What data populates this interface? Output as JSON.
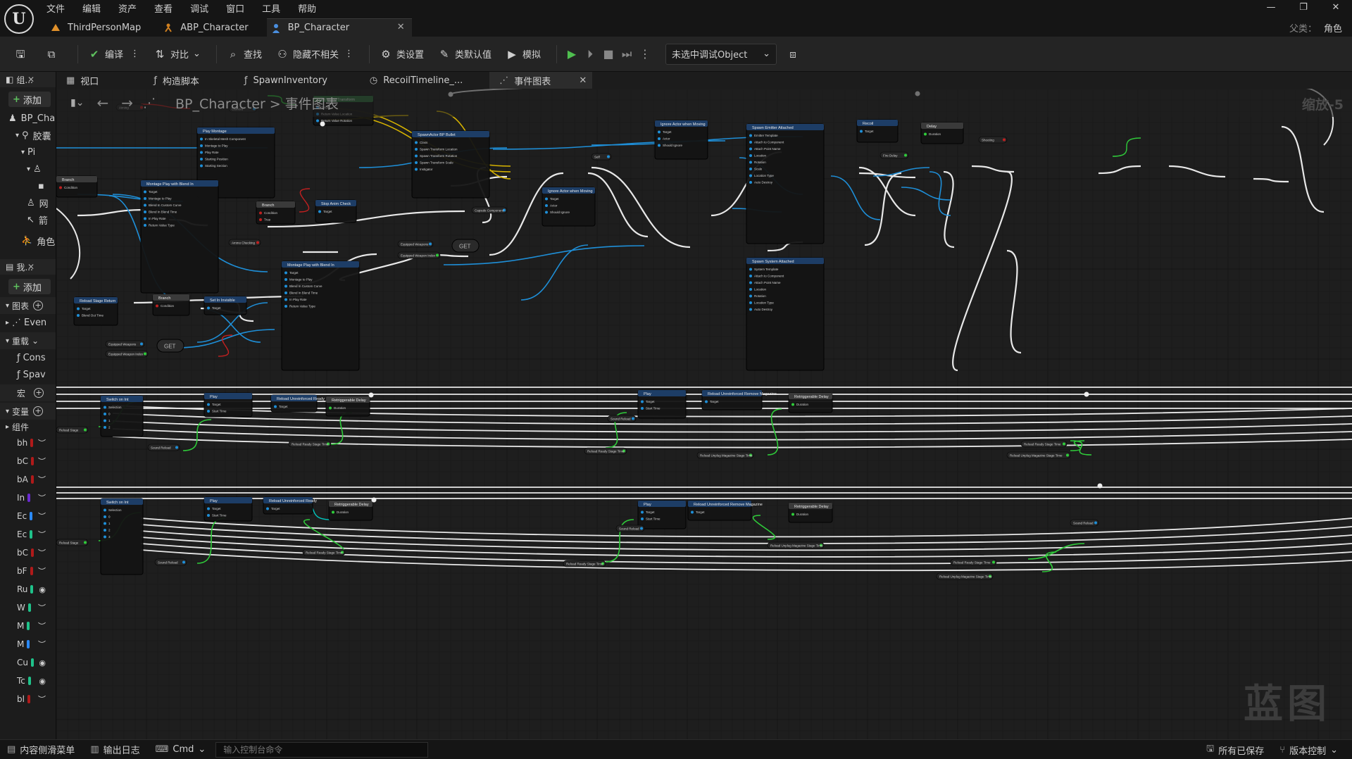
{
  "window": {
    "menu": [
      "文件",
      "编辑",
      "资产",
      "查看",
      "调试",
      "窗口",
      "工具",
      "帮助"
    ],
    "tabs": [
      {
        "label": "ThirdPersonMap",
        "icon": "level-icon"
      },
      {
        "label": "ABP_Character",
        "icon": "anim-blueprint-icon"
      },
      {
        "label": "BP_Character",
        "icon": "blueprint-character-icon",
        "active": true
      }
    ],
    "parent_key": "父类：",
    "parent_value": "角色"
  },
  "toolbar": {
    "compile": "编译",
    "diff": "对比",
    "find": "查找",
    "hide_unrelated": "隐藏不相关",
    "class_settings": "类设置",
    "class_defaults": "类默认值",
    "simulate": "模拟",
    "debug_object": "未选中调试Object"
  },
  "left": {
    "components_header": "组...",
    "add_label": "添加",
    "root_item": "BP_Char",
    "capsule_item": "胶囊",
    "pi_item": "Pi",
    "web_item": "网",
    "arrow_item": "箭",
    "movement_item": "角色",
    "mybp_header": "我...",
    "graphs_section": "图表",
    "event_graph": "Even",
    "overrides_section": "重载",
    "construction": "Cons",
    "spawn": "Spav",
    "macros_section": "宏",
    "vars_section": "变量",
    "components_sub": "组件",
    "vars": [
      {
        "name": "bh",
        "color": "#b01a1a"
      },
      {
        "name": "bC",
        "color": "#b01a1a"
      },
      {
        "name": "bA",
        "color": "#b01a1a"
      },
      {
        "name": "In",
        "color": "#6a2ad0"
      },
      {
        "name": "Ec",
        "color": "#2a8aff"
      },
      {
        "name": "Ec",
        "color": "#1fc28a"
      },
      {
        "name": "bC",
        "color": "#b01a1a"
      },
      {
        "name": "bF",
        "color": "#b01a1a"
      },
      {
        "name": "Ru",
        "color": "#1fc28a"
      },
      {
        "name": "W",
        "color": "#1fc28a"
      },
      {
        "name": "M",
        "color": "#1fc28a"
      },
      {
        "name": "M",
        "color": "#2a8aff"
      },
      {
        "name": "Cu",
        "color": "#1fc28a"
      },
      {
        "name": "Tc",
        "color": "#1fc28a"
      },
      {
        "name": "bl",
        "color": "#b01a1a"
      }
    ]
  },
  "editor_tabs": [
    {
      "label": "视口",
      "glyph": "▦"
    },
    {
      "label": "构造脚本",
      "glyph": "ƒ"
    },
    {
      "label": "SpawnInventory",
      "glyph": "ƒ"
    },
    {
      "label": "RecoilTimeline_...",
      "glyph": "◷"
    },
    {
      "label": "事件图表",
      "glyph": "⋰",
      "active": true
    }
  ],
  "graph": {
    "breadcrumb_root": "BP_Character",
    "breadcrumb_leaf": "事件图表",
    "zoom": "缩放-5",
    "watermark": "蓝图",
    "get_label": "GET",
    "nodes": [
      {
        "title": "Get World Transform",
        "pins": [
          "Target",
          "Return Value Location",
          "Return Value Rotation",
          "Return Value Scale"
        ]
      },
      {
        "title": "Play Montage",
        "pins": [
          "In Skeletal Mesh Component",
          "Montage to Play",
          "Play Rate",
          "Starting Position",
          "Starting Section"
        ]
      },
      {
        "title": "Montage Play with Blend In",
        "pins": [
          "Target",
          "Montage to Play",
          "Blend In Custom Curve",
          "Blend In Blend Time",
          "In Play Rate",
          "Return Value Type"
        ]
      },
      {
        "title": "SpawnActor BP Bullet",
        "pins": [
          "Class",
          "Spawn Transform Location",
          "Spawn Transform Rotation",
          "Spawn Transform Scale",
          "Instigator"
        ]
      },
      {
        "title": "Spawn Emitter Attached",
        "pins": [
          "Emitter Template",
          "Attach to Component",
          "Attach Point Name",
          "Location",
          "Rotation",
          "Scale",
          "Location Type",
          "Auto Destroy"
        ]
      },
      {
        "title": "Spawn System Attached",
        "pins": [
          "System Template",
          "Attach to Component",
          "Attach Point Name",
          "Location",
          "Rotation",
          "Location Type",
          "Auto Destroy"
        ]
      },
      {
        "title": "Ignore Actor when Moving",
        "pins": [
          "Target",
          "Actor",
          "Should Ignore"
        ]
      },
      {
        "title": "Recoil",
        "pins": [
          "Target"
        ]
      },
      {
        "title": "Delay",
        "pins": [
          "Duration",
          "Completed"
        ]
      },
      {
        "title": "Switch on Int",
        "pins": [
          "Selection",
          "0",
          "1",
          "2",
          "3"
        ]
      },
      {
        "title": "Retriggerable Delay",
        "pins": [
          "Duration",
          "Completed"
        ]
      },
      {
        "title": "Reload Unreinforced Ready",
        "pins": [
          "Target"
        ]
      },
      {
        "title": "Reload Unreinforced Remove Magazine",
        "pins": [
          "Target"
        ]
      },
      {
        "title": "Branch",
        "pins": [
          "Condition",
          "True",
          "False"
        ]
      },
      {
        "title": "Stop Anim Check",
        "pins": [
          "Target"
        ]
      }
    ],
    "var_labels": [
      "Aiming",
      "Camera",
      "Equipped Weapons",
      "Equipped Weapon Index",
      "Ammo Checking",
      "Fire Delay",
      "Reload Stage",
      "Sound Reload",
      "Reload Ready Stage Time",
      "Reload Unplug Magazine Stage Time",
      "Reload Thread Stage",
      "Shooting",
      "Capsule Component",
      "Self"
    ]
  },
  "status": {
    "content_drawer": "内容侧滑菜单",
    "output_log": "输出日志",
    "cmd": "Cmd",
    "console_placeholder": "输入控制台命令",
    "all_saved": "所有已保存",
    "source_control": "版本控制"
  }
}
